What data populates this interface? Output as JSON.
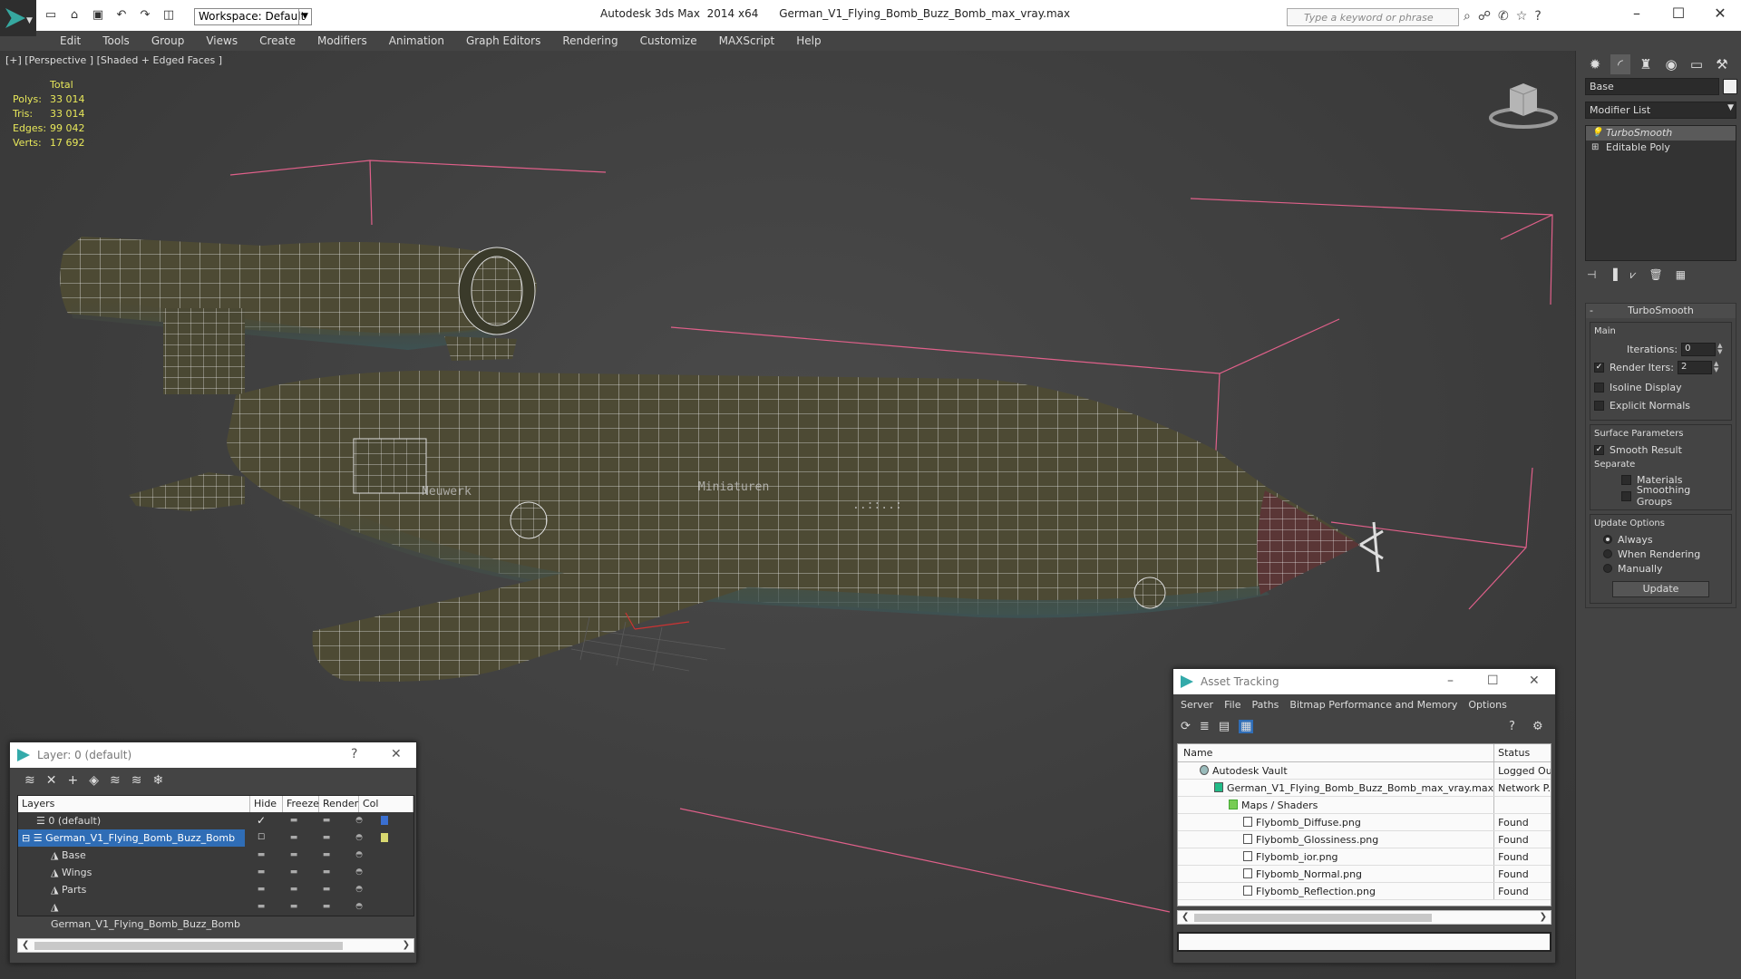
{
  "app": {
    "title": "Autodesk 3ds Max  2014 x64      German_V1_Flying_Bomb_Buzz_Bomb_max_vray.max",
    "workspace": "Workspace: Default",
    "search_placeholder": "Type a keyword or phrase"
  },
  "menu": [
    "Edit",
    "Tools",
    "Group",
    "Views",
    "Create",
    "Modifiers",
    "Animation",
    "Graph Editors",
    "Rendering",
    "Customize",
    "MAXScript",
    "Help"
  ],
  "viewport": {
    "label": "[+] [Perspective ] [Shaded + Edged Faces ]",
    "stats_header": "Total",
    "stats": [
      {
        "label": "Polys:",
        "value": "33 014"
      },
      {
        "label": "Tris:",
        "value": "33 014"
      },
      {
        "label": "Edges:",
        "value": "99 042"
      },
      {
        "label": "Verts:",
        "value": "17 692"
      }
    ]
  },
  "command_panel": {
    "object_name": "Base",
    "modifier_list": "Modifier List",
    "stack": [
      "TurboSmooth",
      "Editable Poly"
    ],
    "rollout_title": "TurboSmooth",
    "main_label": "Main",
    "iterations_label": "Iterations:",
    "iterations_value": "0",
    "render_iters_label": "Render Iters:",
    "render_iters_value": "2",
    "isoline_label": "Isoline Display",
    "explicit_normals_label": "Explicit Normals",
    "surface_params_label": "Surface Parameters",
    "smooth_result_label": "Smooth Result",
    "separate_label": "Separate",
    "materials_label": "Materials",
    "smoothing_groups_label": "Smoothing Groups",
    "update_options_label": "Update Options",
    "always_label": "Always",
    "when_rendering_label": "When Rendering",
    "manually_label": "Manually",
    "update_button": "Update"
  },
  "layer_window": {
    "title": "Layer: 0 (default)",
    "help": "?",
    "columns": [
      "Layers",
      "Hide",
      "Freeze",
      "Render",
      "Col"
    ],
    "rows": [
      {
        "name": "0 (default)",
        "color": "#3a6fd0"
      },
      {
        "name": "German_V1_Flying_Bomb_Buzz_Bomb",
        "color": "#d8d870"
      },
      {
        "name": "Base",
        "color": "#dddddd"
      },
      {
        "name": "Wings",
        "color": "#dddddd"
      },
      {
        "name": "Parts",
        "color": "#dddddd"
      },
      {
        "name": "German_V1_Flying_Bomb_Buzz_Bomb",
        "color": "#111111"
      }
    ]
  },
  "asset_window": {
    "title": "Asset Tracking",
    "menu": [
      "Server",
      "File",
      "Paths",
      "Bitmap Performance and Memory",
      "Options"
    ],
    "columns": [
      "Name",
      "Status"
    ],
    "rows": [
      {
        "name": "Autodesk Vault",
        "status": "Logged Ou"
      },
      {
        "name": "German_V1_Flying_Bomb_Buzz_Bomb_max_vray.max",
        "status": "Network P..."
      },
      {
        "name": "Maps / Shaders",
        "status": ""
      },
      {
        "name": "Flybomb_Diffuse.png",
        "status": "Found"
      },
      {
        "name": "Flybomb_Glossiness.png",
        "status": "Found"
      },
      {
        "name": "Flybomb_ior.png",
        "status": "Found"
      },
      {
        "name": "Flybomb_Normal.png",
        "status": "Found"
      },
      {
        "name": "Flybomb_Reflection.png",
        "status": "Found"
      }
    ]
  },
  "colors": {
    "selection_blue": "#2f6db6",
    "bbox_pink": "#e0608a",
    "stats_yellow": "#e8e85a",
    "model_olive": "#4d4a34"
  }
}
